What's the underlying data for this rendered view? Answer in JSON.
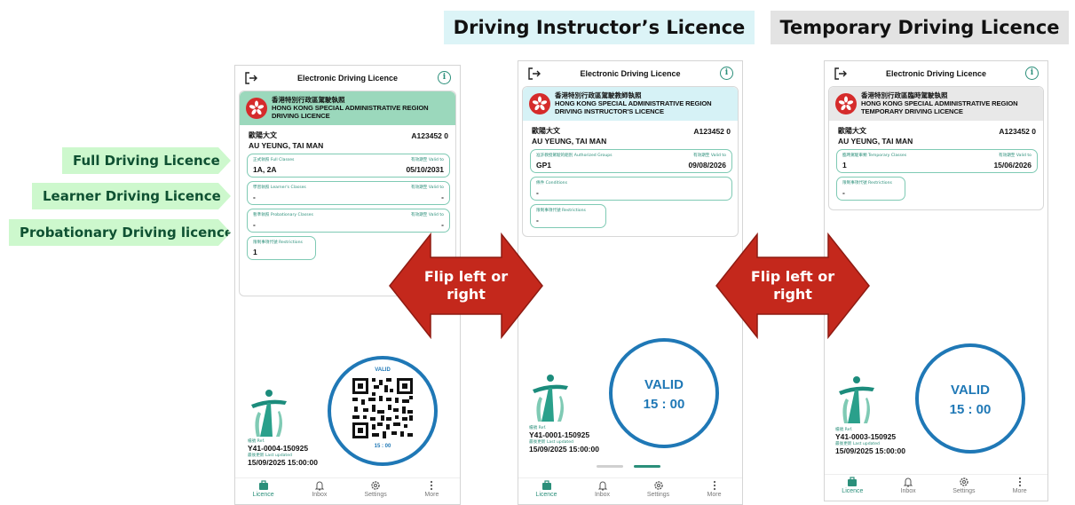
{
  "headings": {
    "instructor": "Driving Instructor’s Licence",
    "temporary": "Temporary Driving Licence"
  },
  "callouts": {
    "full": "Full Driving Licence",
    "learner": "Learner Driving Licence",
    "probationary": "Probationary Driving licence"
  },
  "arrows": [
    {
      "label_line1": "Flip left or",
      "label_line2": "right"
    },
    {
      "label_line1": "Flip left or",
      "label_line2": "right"
    }
  ],
  "colors": {
    "accent": "#2b8f7a",
    "status_ring": "#1f78b6",
    "arrow": "#c4281c",
    "full_band": "#9bd8bc",
    "instructor_band": "#d6f2f6",
    "temporary_band": "#e8e8e8"
  },
  "nav": {
    "licence": "Licence",
    "inbox": "Inbox",
    "settings": "Settings",
    "more": "More"
  },
  "app_title": "Electronic Driving Licence",
  "phones": [
    {
      "authority_cn": "香港特別行政區駕駛執照",
      "authority_en": "HONG KONG SPECIAL ADMINISTRATIVE REGION",
      "licence_type": "DRIVING LICENCE",
      "name_cn": "歐陽大文",
      "name_en": "AU YEUNG, TAI MAN",
      "licence_no": "A123452 0",
      "fields": [
        {
          "label": "正式執照 Full Classes",
          "value": "1A, 2A",
          "right_label": "有效期至 Valid to",
          "right_value": "05/10/2031"
        },
        {
          "label": "學習執照 Learner's Classes",
          "value": "-",
          "right_label": "有效期至 Valid to",
          "right_value": "-"
        },
        {
          "label": "暫準執照 Probationary Classes",
          "value": "-",
          "right_label": "有效期至 Valid to",
          "right_value": "-"
        },
        {
          "label": "限制事項代號 Restrictions",
          "value": "1"
        }
      ],
      "ref_label": "檔號 Ref.",
      "ref": "Y41-0004-150925",
      "updated_label": "最後更新 Last updated",
      "updated": "15/09/2025 15:00:00",
      "status": "VALID",
      "time": "15 : 00"
    },
    {
      "authority_cn": "香港特別行政區駕駛教師執照",
      "authority_en": "HONG KONG SPECIAL ADMINISTRATIVE REGION",
      "licence_type": "DRIVING INSTRUCTOR'S LICENCE",
      "name_cn": "歐陽大文",
      "name_en": "AU YEUNG, TAI MAN",
      "licence_no": "A123452 0",
      "fields": [
        {
          "label": "准許教授駕駛的組別 Authorized Groups",
          "value": "GP1",
          "right_label": "有效期至 Valid to",
          "right_value": "09/08/2026"
        },
        {
          "label": "條件 Conditions",
          "value": "-"
        },
        {
          "label": "限制事項代號 Restrictions",
          "value": "-"
        }
      ],
      "ref_label": "檔號 Ref.",
      "ref": "Y41-0001-150925",
      "updated_label": "最後更新 Last updated",
      "updated": "15/09/2025 15:00:00",
      "status": "VALID",
      "time": "15 : 00"
    },
    {
      "authority_cn": "香港特別行政區臨時駕駛執照",
      "authority_en": "HONG KONG SPECIAL ADMINISTRATIVE REGION",
      "licence_type": "TEMPORARY DRIVING LICENCE",
      "name_cn": "歐陽大文",
      "name_en": "AU YEUNG, TAI MAN",
      "licence_no": "A123452 0",
      "fields": [
        {
          "label": "臨時駕駛車類 Temporary Classes",
          "value": "1",
          "right_label": "有效期至 Valid to",
          "right_value": "15/06/2026"
        },
        {
          "label": "限制事項代號 Restrictions",
          "value": "-"
        }
      ],
      "ref_label": "檔號 Ref.",
      "ref": "Y41-0003-150925",
      "updated_label": "最後更新 Last updated",
      "updated": "15/09/2025 15:00:00",
      "status": "VALID",
      "time": "15 : 00"
    }
  ]
}
